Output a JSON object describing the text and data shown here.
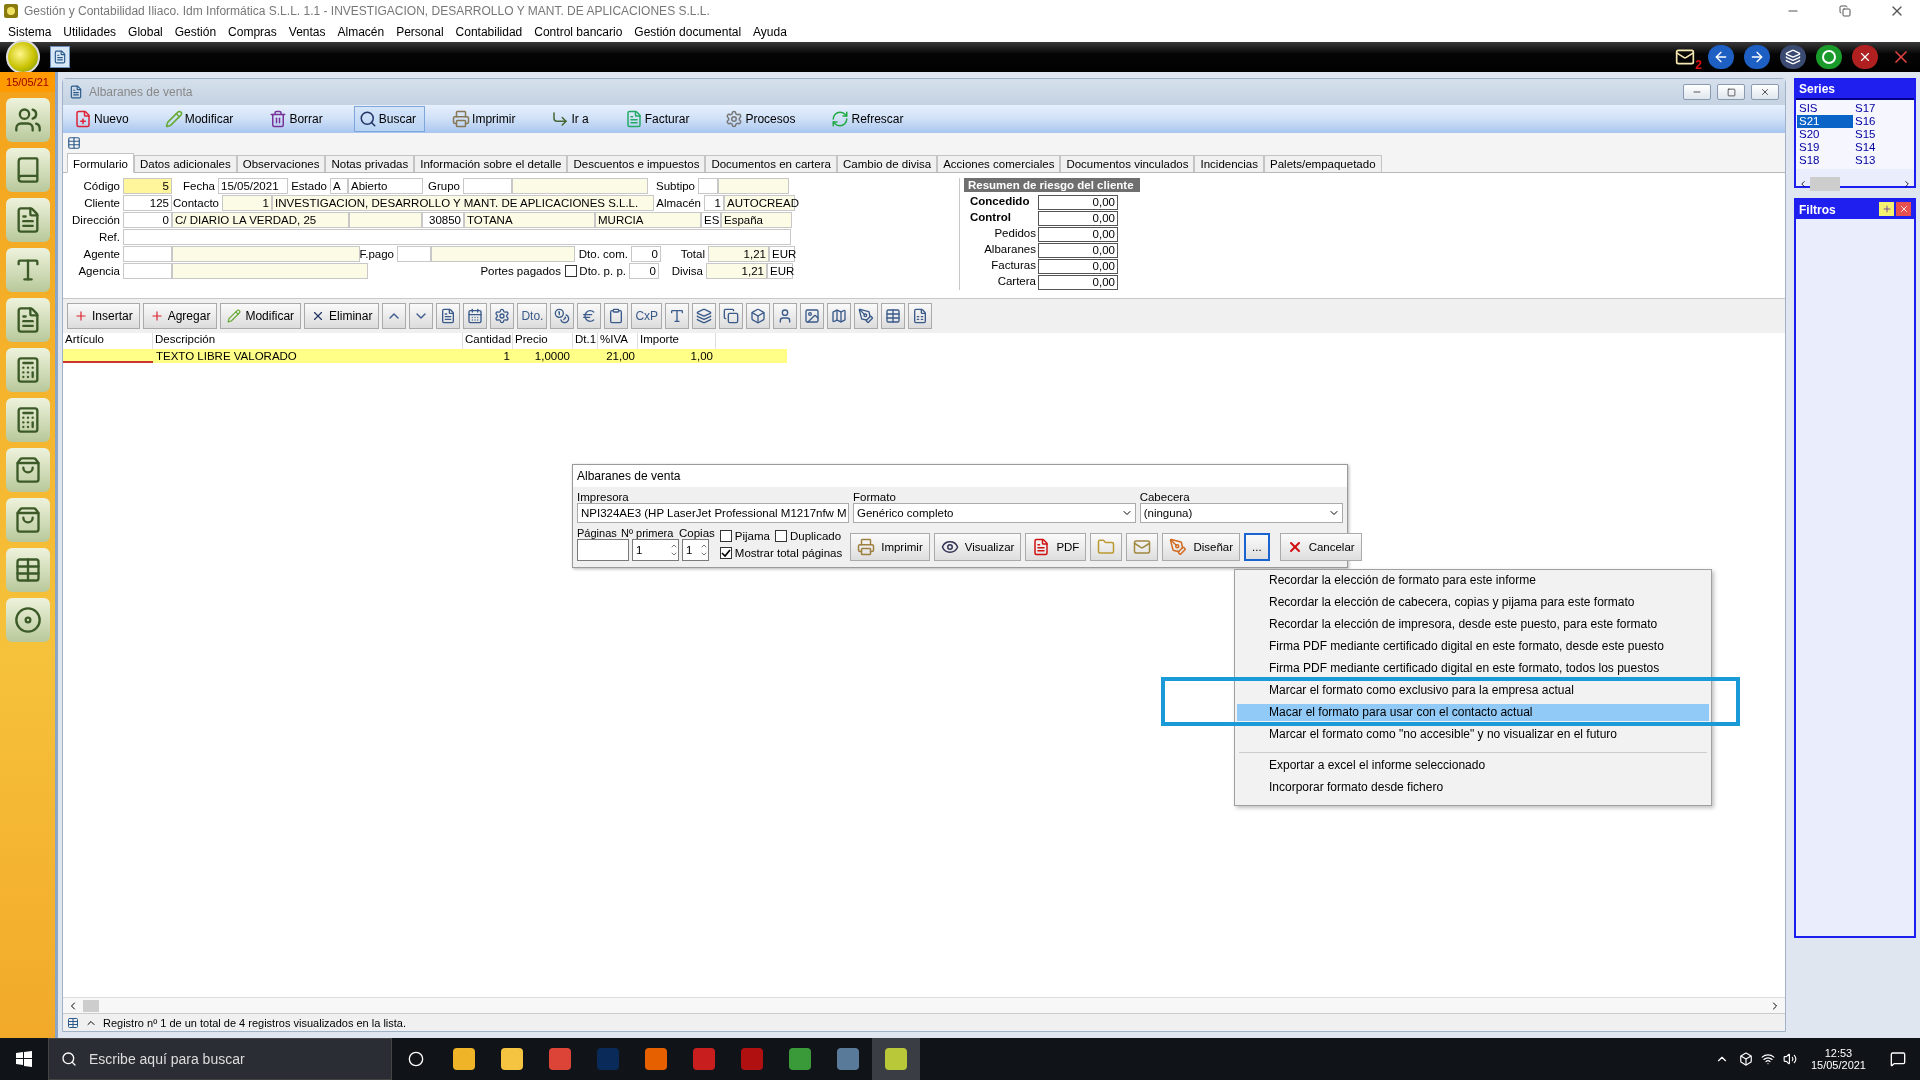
{
  "window": {
    "title": "Gestión y Contabilidad Iliaco. Idm Informática S.L.L. 1.1 - INVESTIGACION, DESARROLLO Y MANT. DE APLICACIONES S.L.L."
  },
  "menu_bar": [
    "Sistema",
    "Utilidades",
    "Global",
    "Gestión",
    "Compras",
    "Ventas",
    "Almacén",
    "Personal",
    "Contabilidad",
    "Control bancario",
    "Gestión documental",
    "Ayuda"
  ],
  "app_bar": {
    "mail_count": "2"
  },
  "sidebar": {
    "date": "15/05/21"
  },
  "document": {
    "title": "Albaranes de venta",
    "toolbar": [
      {
        "label": "Nuevo",
        "selected": false
      },
      {
        "label": "Modificar",
        "selected": false
      },
      {
        "label": "Borrar",
        "selected": false
      },
      {
        "label": "Buscar",
        "selected": true
      },
      {
        "label": "Imprimir",
        "selected": false
      },
      {
        "label": "Ir a",
        "selected": false
      },
      {
        "label": "Facturar",
        "selected": false
      },
      {
        "label": "Procesos",
        "selected": false
      },
      {
        "label": "Refrescar",
        "selected": false
      }
    ],
    "tabs": [
      {
        "label": "Formulario",
        "selected": true
      },
      {
        "label": "Datos adicionales",
        "selected": false
      },
      {
        "label": "Observaciones",
        "selected": false
      },
      {
        "label": "Notas privadas",
        "selected": false
      },
      {
        "label": "Información sobre el detalle",
        "selected": false
      },
      {
        "label": "Descuentos e impuestos",
        "selected": false
      },
      {
        "label": "Documentos en cartera",
        "selected": false
      },
      {
        "label": "Cambio de divisa",
        "selected": false
      },
      {
        "label": "Acciones comerciales",
        "selected": false
      },
      {
        "label": "Documentos vinculados",
        "selected": false
      },
      {
        "label": "Incidencias",
        "selected": false
      },
      {
        "label": "Palets/empaquetado",
        "selected": false
      }
    ],
    "form": {
      "lines": [
        {
          "fields": [
            {
              "label": "Código",
              "inputs": [
                {
                  "kind": "key",
                  "text": "5"
                }
              ]
            },
            {
              "label": "Fecha",
              "inputs": [
                {
                  "kind": "field",
                  "text": "15/05/2021"
                }
              ]
            },
            {
              "label": "Estado",
              "inputs": [
                {
                  "kind": "field",
                  "text": "A"
                },
                {
                  "kind": "field",
                  "text": "Abierto"
                }
              ]
            },
            {
              "label": "Grupo",
              "inputs": [
                {
                  "kind": "field"
                },
                {
                  "kind": "shaded"
                }
              ]
            },
            {
              "label": "Subtipo",
              "inputs": [
                {
                  "kind": "field"
                },
                {
                  "kind": "shaded"
                }
              ]
            }
          ]
        },
        {
          "fields": [
            {
              "label": "Cliente",
              "inputs": [
                {
                  "kind": "field",
                  "text": "125"
                }
              ]
            },
            {
              "label": "Contacto",
              "inputs": [
                {
                  "kind": "shaded",
                  "text": "1"
                },
                {
                  "kind": "shaded",
                  "text": "INVESTIGACION, DESARROLLO Y MANT. DE APLICACIONES S.L.L."
                }
              ]
            },
            {
              "label": "Almacén",
              "inputs": [
                {
                  "kind": "field",
                  "text": "1"
                },
                {
                  "kind": "shaded",
                  "text": "AUTOCREAD"
                }
              ]
            }
          ]
        },
        {
          "fields": [
            {
              "label": "Dirección",
              "inputs": [
                {
                  "kind": "field",
                  "text": "0"
                },
                {
                  "kind": "shaded",
                  "text": "C/ DIARIO LA VERDAD, 25"
                },
                {
                  "kind": "shaded"
                },
                {
                  "kind": "field",
                  "text": "30850"
                },
                {
                  "kind": "shaded",
                  "text": "TOTANA"
                },
                {
                  "kind": "shaded",
                  "text": "MURCIA"
                },
                {
                  "kind": "field",
                  "text": "ES"
                },
                {
                  "kind": "shaded",
                  "text": "España"
                }
              ]
            }
          ]
        },
        {
          "fields": [
            {
              "label": "Ref.",
              "inputs": [
                {
                  "kind": "field"
                }
              ]
            }
          ]
        },
        {
          "fields": [
            {
              "label": "Agente",
              "inputs": [
                {
                  "kind": "field"
                },
                {
                  "kind": "shaded"
                }
              ]
            },
            {
              "label": "F.pago",
              "inputs": [
                {
                  "kind": "field"
                },
                {
                  "kind": "shaded"
                }
              ]
            },
            {
              "label": "Dto. com.",
              "inputs": [
                {
                  "kind": "field",
                  "text": "0"
                }
              ]
            },
            {
              "label": "Total",
              "inputs": [
                {
                  "kind": "shaded",
                  "text": "1,21"
                },
                {
                  "kind": "field",
                  "text": "EUR"
                }
              ]
            }
          ]
        },
        {
          "fields": [
            {
              "label": "Agencia",
              "inputs": [
                {
                  "kind": "field"
                },
                {
                  "kind": "shaded"
                }
              ]
            },
            {
              "label": "Portes pagados",
              "inputs": [
                {
                  "kind": "check",
                  "checked": false
                }
              ]
            },
            {
              "label": "Dto. p. p.",
              "inputs": [
                {
                  "kind": "field",
                  "text": "0"
                }
              ]
            },
            {
              "label": "Divisa",
              "inputs": [
                {
                  "kind": "shaded",
                  "text": "1,21"
                },
                {
                  "kind": "field",
                  "text": "EUR"
                }
              ]
            }
          ]
        }
      ]
    },
    "risk_summary": {
      "title": "Resumen de riesgo del cliente",
      "rows": [
        {
          "label": "Concedido",
          "bold": true,
          "value": "0,00"
        },
        {
          "label": "Control",
          "bold": true,
          "value": "0,00"
        },
        {
          "label": "Pedidos",
          "bold": false,
          "value": "0,00"
        },
        {
          "label": "Albaranes",
          "bold": false,
          "value": "0,00"
        },
        {
          "label": "Facturas",
          "bold": false,
          "value": "0,00"
        },
        {
          "label": "Cartera",
          "bold": false,
          "value": "0,00"
        }
      ]
    },
    "detail_toolbar": {
      "buttons": [
        "Insertar",
        "Agregar",
        "Modificar",
        "Eliminar"
      ],
      "text_tools": [
        "Dto.",
        "CxP"
      ]
    },
    "lines": {
      "columns": [
        "Artículo",
        "Descripción",
        "Cantidad",
        "Precio",
        "Dt.1",
        "%IVA",
        "Importe"
      ],
      "rows": [
        {
          "selected": true,
          "descripcion": "TEXTO LIBRE VALORADO",
          "cantidad": "1",
          "precio": "1,0000",
          "iva": "21,00",
          "importe": "1,00"
        }
      ]
    },
    "status": "Registro nº 1 de un total de 4 registros visualizados en la lista."
  },
  "series_panel": {
    "title": "Series",
    "items": [
      {
        "label": "SIS",
        "selected": false
      },
      {
        "label": "S21",
        "selected": true
      },
      {
        "label": "S20",
        "selected": false
      },
      {
        "label": "S19",
        "selected": false
      },
      {
        "label": "S18",
        "selected": false
      },
      {
        "label": "S17",
        "selected": false
      },
      {
        "label": "S16",
        "selected": false
      },
      {
        "label": "S15",
        "selected": false
      },
      {
        "label": "S14",
        "selected": false
      },
      {
        "label": "S13",
        "selected": false
      }
    ]
  },
  "filters_panel": {
    "title": "Filtros"
  },
  "print_dialog": {
    "title": "Albaranes de venta",
    "selects": [
      {
        "label": "Impresora",
        "value": "NPI324AE3 (HP LaserJet Professional M1217nfw M"
      },
      {
        "label": "Formato",
        "value": "Genérico completo"
      },
      {
        "label": "Cabecera",
        "value": "(ninguna)"
      }
    ],
    "pages_label": "Páginas",
    "first_label": "Nº primera",
    "first_value": "1",
    "copies_label": "Copias",
    "copies_value": "1",
    "checks": [
      {
        "label": "Pijama",
        "checked": false
      },
      {
        "label": "Duplicado",
        "checked": false
      },
      {
        "label": "Mostrar total páginas",
        "checked": true
      }
    ],
    "buttons": [
      {
        "label": "Imprimir",
        "kind": "print"
      },
      {
        "label": "Visualizar",
        "kind": "preview"
      },
      {
        "label": "PDF",
        "kind": "pdf"
      },
      {
        "kind": "folder"
      },
      {
        "kind": "mail"
      },
      {
        "label": "Diseñar",
        "kind": "design"
      },
      {
        "label": "...",
        "kind": "more",
        "selected": true
      },
      {
        "label": "Cancelar",
        "kind": "cancel"
      }
    ]
  },
  "context_menu": {
    "groups": [
      [
        {
          "label": "Recordar la elección de formato para este informe",
          "selected": false
        },
        {
          "label": "Recordar la elección de cabecera, copias y pijama para este formato",
          "selected": false
        },
        {
          "label": "Recordar la elección de impresora, desde este puesto, para este formato",
          "selected": false
        },
        {
          "label": "Firma PDF mediante certificado digital en este formato, desde este puesto",
          "selected": false
        },
        {
          "label": "Firma PDF mediante certificado digital en este formato, todos los puestos",
          "selected": false
        },
        {
          "label": "Marcar el formato como exclusivo para la empresa actual",
          "selected": false
        },
        {
          "label": "Macar el formato para usar con el contacto actual",
          "selected": true
        },
        {
          "label": "Marcar el formato como \"no accesible\" y no visualizar en el futuro",
          "selected": false
        }
      ],
      [
        {
          "label": "Exportar a excel el informe seleccionado",
          "selected": false
        },
        {
          "label": "Incorporar formato desde fichero",
          "selected": false
        }
      ]
    ]
  },
  "taskbar": {
    "search_placeholder": "Escribe aquí para buscar",
    "time": "12:53",
    "date": "15/05/2021"
  }
}
